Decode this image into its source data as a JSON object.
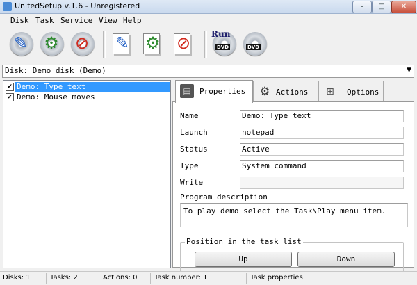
{
  "window": {
    "title": "UnitedSetup v.1.6 - Unregistered",
    "controls": {
      "minimize": "–",
      "maximize": "□",
      "close": "✕"
    }
  },
  "menu": [
    "Disk",
    "Task",
    "Service",
    "View",
    "Help"
  ],
  "toolbar": {
    "buttons": [
      {
        "icon": "new-disk-icon"
      },
      {
        "icon": "disk-settings-icon"
      },
      {
        "icon": "delete-disk-icon"
      },
      {
        "icon": "new-task-icon"
      },
      {
        "icon": "task-settings-icon"
      },
      {
        "icon": "delete-task-icon"
      },
      {
        "icon": "run-dvd-icon",
        "label": "Run",
        "badge": "DVD"
      },
      {
        "icon": "burn-dvd-icon",
        "badge": "DVD"
      }
    ]
  },
  "disk_selector": {
    "value": "Disk: Demo disk (Demo)"
  },
  "tasks": [
    {
      "label": "Demo: Type text",
      "checked": true,
      "selected": true
    },
    {
      "label": "Demo: Mouse moves",
      "checked": true,
      "selected": false
    }
  ],
  "tabs": [
    {
      "label": "Properties",
      "icon": "properties-icon",
      "active": true
    },
    {
      "label": "Actions",
      "icon": "actions-gear-icon",
      "active": false
    },
    {
      "label": "Options",
      "icon": "options-icon",
      "active": false
    }
  ],
  "properties": {
    "fields": [
      {
        "label": "Name",
        "value": "Demo: Type text"
      },
      {
        "label": "Launch",
        "value": "notepad"
      },
      {
        "label": "Status",
        "value": "Active"
      },
      {
        "label": "Type",
        "value": "System command"
      },
      {
        "label": "Write",
        "value": ""
      }
    ],
    "description_label": "Program description",
    "description": "To play demo select the Task\\Play menu item.",
    "position_group": {
      "legend": "Position in the task list",
      "up": "Up",
      "down": "Down"
    }
  },
  "status_bar": {
    "disks": "Disks: 1",
    "tasks": "Tasks: 2",
    "actions": "Actions: 0",
    "task_number": "Task number: 1",
    "panel": "Task properties"
  },
  "colors": {
    "selection": "#3399ff",
    "title_gradient_top": "#dfe9f5",
    "close_button": "#c8503c"
  }
}
